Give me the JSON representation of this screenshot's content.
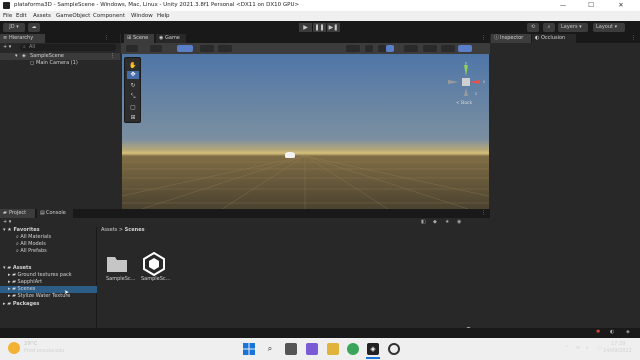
{
  "window": {
    "title": "plataforma3D - SampleScene - Windows, Mac, Linux - Unity 2021.3.8f1 Personal <DX11 on DX10 GPU>",
    "minimize": "—",
    "maximize": "☐",
    "close": "✕"
  },
  "menu": [
    "File",
    "Edit",
    "Assets",
    "GameObject",
    "Component",
    "Window",
    "Help"
  ],
  "toolbar": {
    "account": "JD ▾",
    "layers": "Layers",
    "layout": "Layout",
    "play": "▶",
    "pause": "❚❚",
    "step": "▶❚"
  },
  "hierarchy": {
    "tab": "Hierarchy",
    "add": "+ ▾",
    "search_placeholder": "All",
    "scene": "SampleScene",
    "items": [
      "Main Camera (1)"
    ]
  },
  "scene_tabs": {
    "scene": "Scene",
    "game": "Game"
  },
  "gizmo": {
    "back_label": "< Back",
    "axis_x": "x",
    "axis_y": "y",
    "axis_z": "z"
  },
  "inspector": {
    "tab": "Inspector",
    "occlusion_tab": "Occlusion"
  },
  "project": {
    "tab": "Project",
    "console_tab": "Console",
    "favorites_label": "Favorites",
    "favorites": [
      "All Materials",
      "All Models",
      "All Prefabs"
    ],
    "assets_label": "Assets",
    "assets": [
      "Ground textures pack",
      "SapphiArt",
      "Scenes",
      "Stylize Water Texture"
    ],
    "selected_index": 2,
    "packages_label": "Packages",
    "breadcrumb": {
      "root": "Assets",
      "sep": ">",
      "current": "Scenes"
    },
    "files": [
      {
        "name": "SampleSc...",
        "icon": "folder-icon"
      },
      {
        "name": "SampleSc...",
        "icon": "unity-scene-icon"
      }
    ]
  },
  "taskbar": {
    "weather_temp": "29°C",
    "weather_desc": "Pred ensolarado",
    "time": "17:39",
    "date": "14/09/2022",
    "lang": "POR"
  }
}
